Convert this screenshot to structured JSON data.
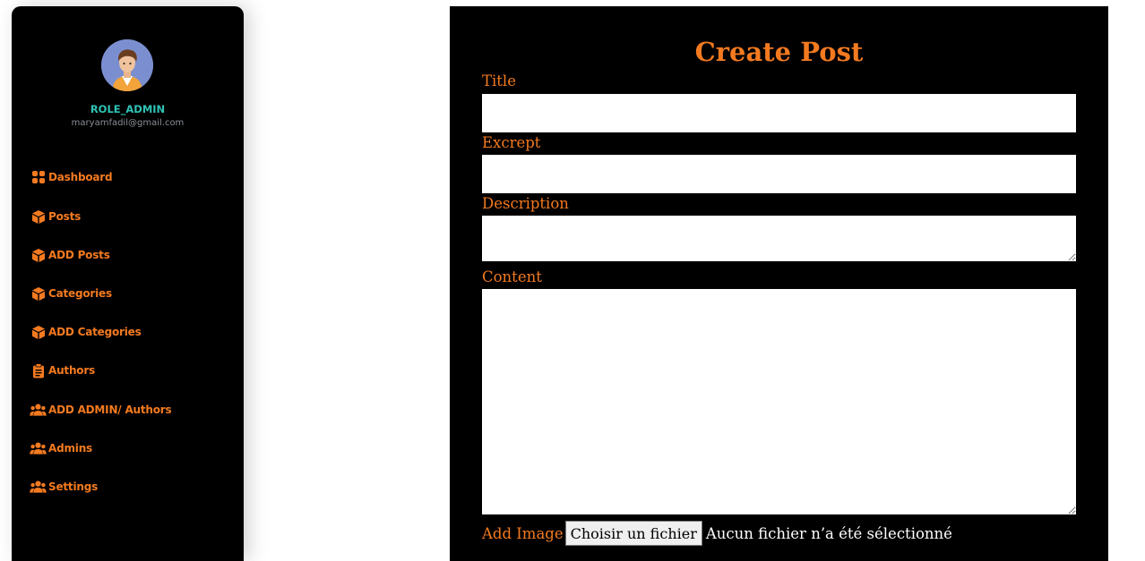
{
  "sidebar": {
    "profile": {
      "role": "ROLE_ADMIN",
      "email": "maryamfadil@gmail.com"
    },
    "items": [
      {
        "label": "Dashboard",
        "icon": "grid-icon"
      },
      {
        "label": "Posts",
        "icon": "cube-icon"
      },
      {
        "label": "ADD Posts",
        "icon": "cube-icon"
      },
      {
        "label": "Categories",
        "icon": "cube-icon"
      },
      {
        "label": "ADD Categories",
        "icon": "cube-icon"
      },
      {
        "label": "Authors",
        "icon": "clipboard-icon"
      },
      {
        "label": "ADD ADMIN/ Authors",
        "icon": "users-icon"
      },
      {
        "label": "Admins",
        "icon": "users-icon"
      },
      {
        "label": "Settings",
        "icon": "users-icon"
      }
    ]
  },
  "form": {
    "title": "Create Post",
    "fields": {
      "title_label": "Title",
      "title_value": "",
      "excerpt_label": "Excrept",
      "excerpt_value": "",
      "description_label": "Description",
      "description_value": "",
      "content_label": "Content",
      "content_value": ""
    },
    "image": {
      "label": "Add Image",
      "button": "Choisir un fichier",
      "status": "Aucun fichier n’a été sélectionné"
    }
  },
  "colors": {
    "accent": "#f47a20",
    "role": "#2ec4b6",
    "panel": "#000000"
  }
}
